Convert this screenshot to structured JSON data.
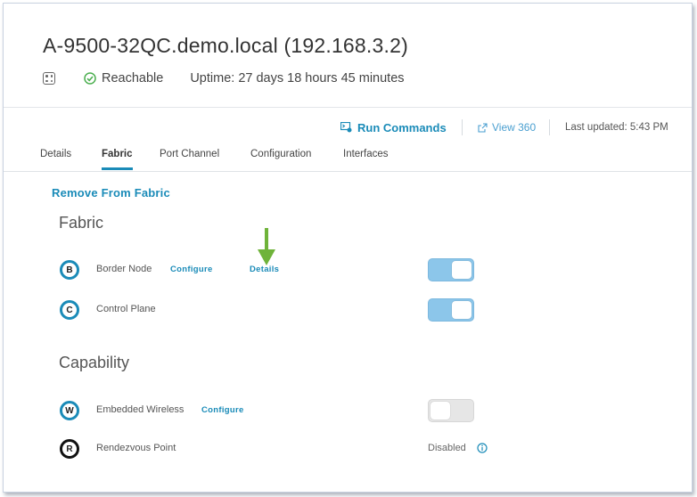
{
  "device": {
    "title": "A-9500-32QC.demo.local (192.168.3.2)",
    "status": "Reachable",
    "uptime": "Uptime: 27 days 18 hours 45 minutes"
  },
  "actions": {
    "run_commands": "Run Commands",
    "view_360": "View 360",
    "last_updated": "Last updated: 5:43 PM"
  },
  "tabs": [
    {
      "label": "Details"
    },
    {
      "label": "Fabric",
      "active": true
    },
    {
      "label": "Port Channel"
    },
    {
      "label": "Configuration"
    },
    {
      "label": "Interfaces"
    }
  ],
  "remove_from_fabric": "Remove From Fabric",
  "fabric": {
    "title": "Fabric",
    "rows": [
      {
        "letter": "B",
        "label": "Border Node",
        "configure": "Configure",
        "details": "Details",
        "toggle": "on"
      },
      {
        "letter": "C",
        "label": "Control Plane",
        "toggle": "on"
      }
    ]
  },
  "capability": {
    "title": "Capability",
    "rows": [
      {
        "letter": "W",
        "label": "Embedded Wireless",
        "configure": "Configure",
        "toggle": "off"
      },
      {
        "letter": "R",
        "label": "Rendezvous Point",
        "state": "Disabled"
      }
    ]
  },
  "colors": {
    "accent": "#1a8bb8",
    "toggle_on": "#8cc6ea",
    "toggle_off": "#e6e6e6",
    "status_ok": "#4caf50",
    "annotation_arrow": "#6fb33a"
  }
}
